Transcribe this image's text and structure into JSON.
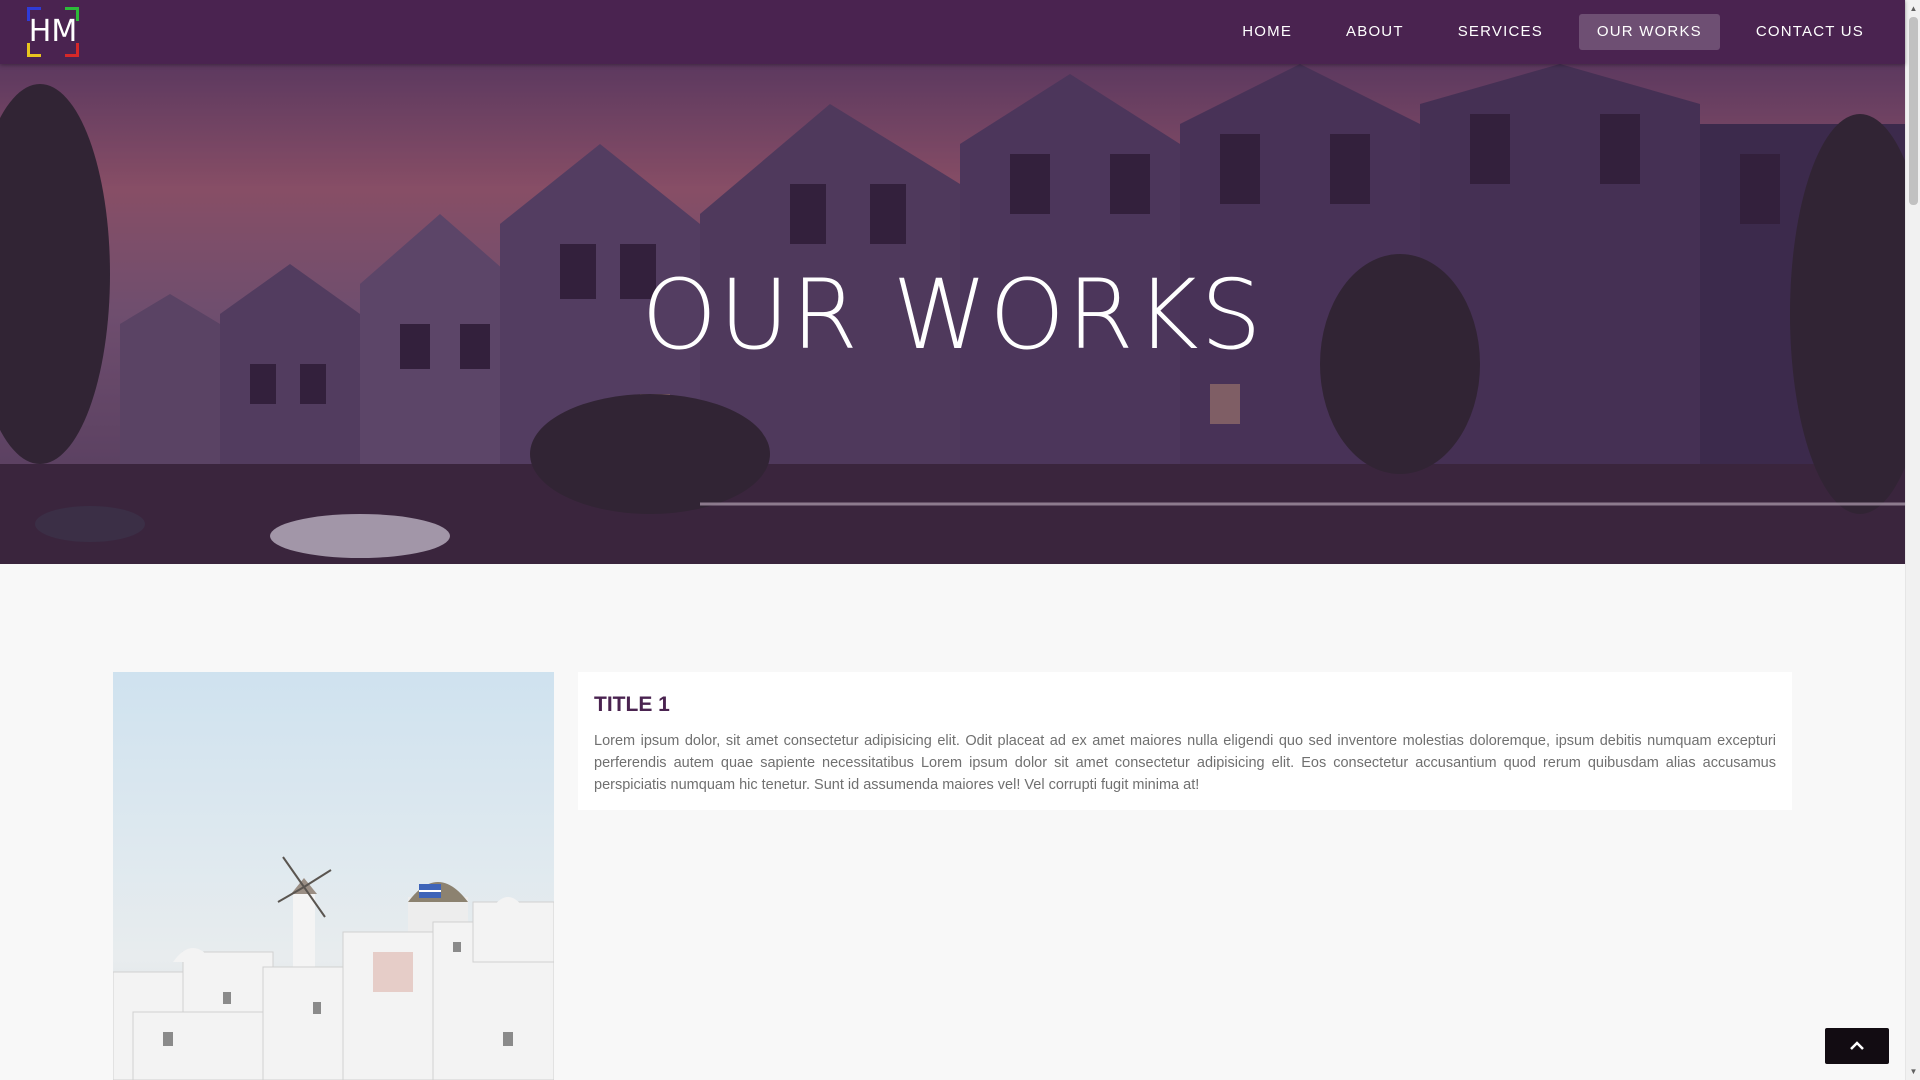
{
  "brand": {
    "logo_text": "HM",
    "colors": {
      "primary": "#4a2350",
      "top_left": "#2f3bd8",
      "top_right": "#2dbb3a",
      "bottom_left": "#e8c51e",
      "bottom_right": "#d62828"
    }
  },
  "nav": {
    "items": [
      {
        "label": "HOME",
        "active": false
      },
      {
        "label": "ABOUT",
        "active": false
      },
      {
        "label": "SERVICES",
        "active": false
      },
      {
        "label": "OUR WORKS",
        "active": true
      },
      {
        "label": "CONTACT US",
        "active": false
      }
    ]
  },
  "hero": {
    "title": "OUR WORKS"
  },
  "works": [
    {
      "title": "TITLE 1",
      "text": "Lorem ipsum dolor, sit amet consectetur adipisicing elit. Odit placeat ad ex amet maiores nulla eligendi quo sed inventore molestias doloremque, ipsum debitis numquam excepturi perferendis autem quae sapiente necessitatibus Lorem ipsum dolor sit amet consectetur adipisicing elit. Eos consectetur accusantium quod rerum quibusdam alias accusamus perspiciatis numquam hic tenetur. Sunt id assumenda maiores vel! Vel corrupti fugit minima at!"
    }
  ],
  "icons": {
    "back_to_top": "chevron-up-icon",
    "scroll_up": "scroll-up-arrow",
    "scroll_down": "scroll-down-arrow"
  }
}
